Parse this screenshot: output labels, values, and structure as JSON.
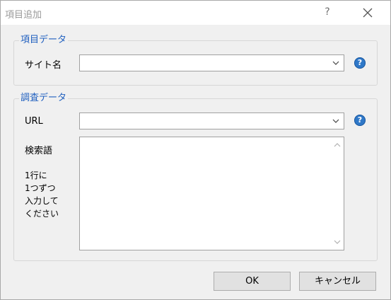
{
  "window": {
    "title": "項目追加",
    "help_label": "?"
  },
  "item_group": {
    "title": "項目データ",
    "site_name_label": "サイト名",
    "site_name_value": ""
  },
  "survey_group": {
    "title": "調査データ",
    "url_label": "URL",
    "url_value": "",
    "search_terms_label": "検索語",
    "search_terms_hint": [
      "1行に",
      "1つずつ",
      "入力して",
      "ください"
    ],
    "search_terms_value": ""
  },
  "buttons": {
    "ok": "OK",
    "cancel": "キャンセル"
  },
  "colors": {
    "group_title": "#1f5fbf",
    "help_icon": "#2f78c8"
  }
}
